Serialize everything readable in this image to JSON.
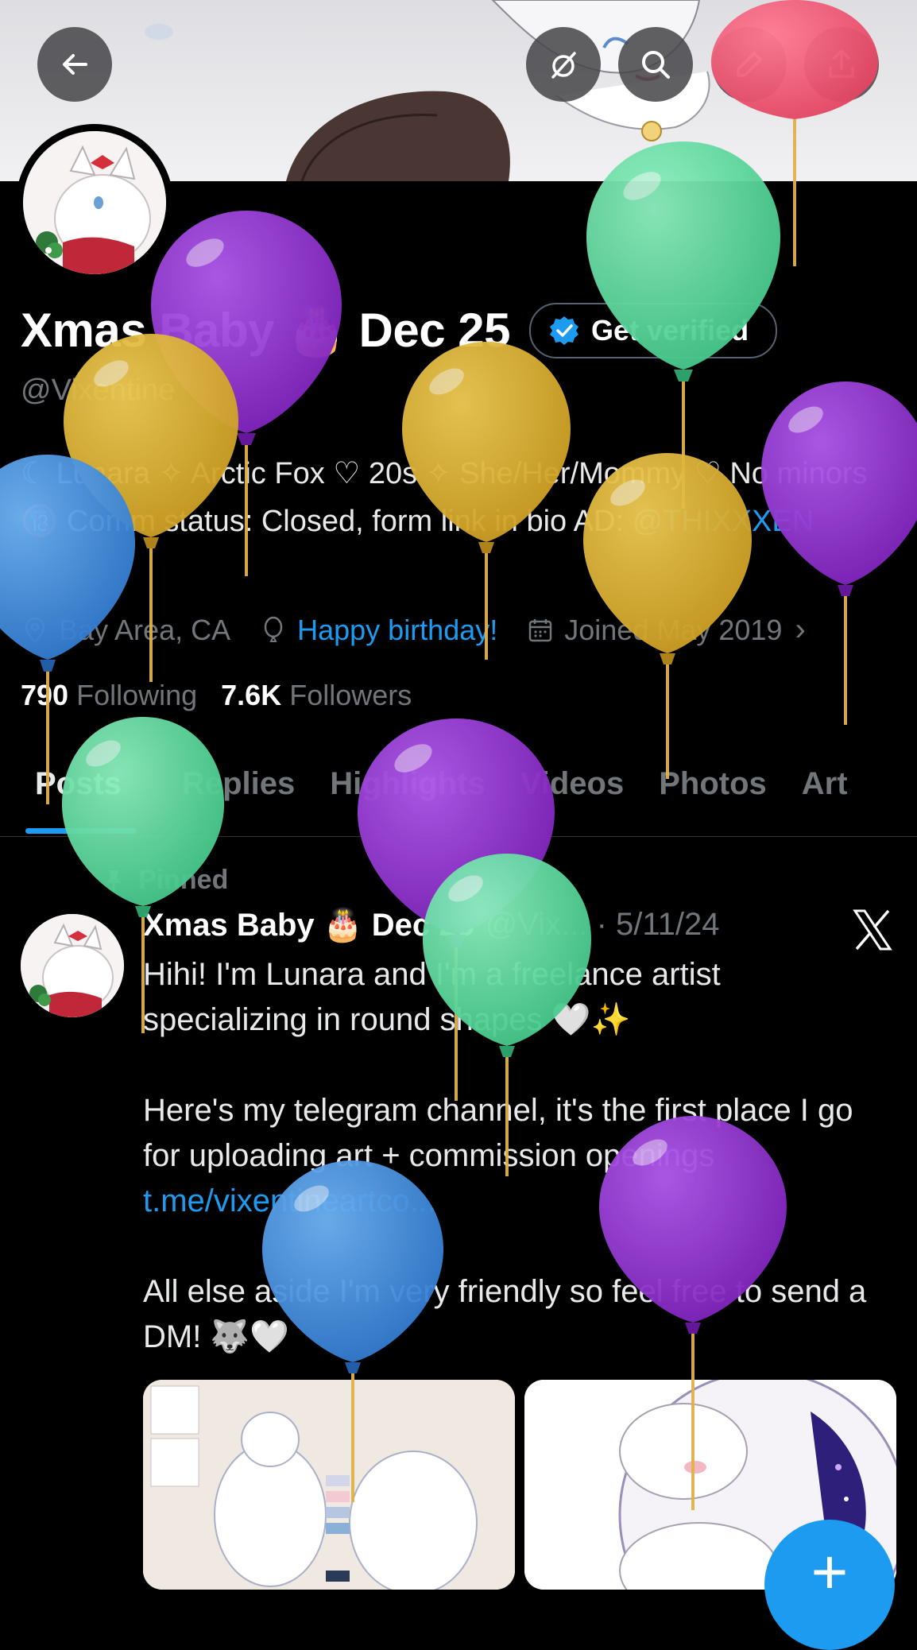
{
  "header": {
    "back_icon": "arrow-left-icon",
    "right_icons": [
      "no-signal-icon",
      "search-icon",
      "edit-icon",
      "share-icon"
    ]
  },
  "profile": {
    "display_name": "Xmas Baby 🎂 Dec 25",
    "verify_label": "Get verified",
    "handle": "@Vixentine",
    "bio_text": "☾ Lunara ✧ Arctic Fox ♡ 20s ✧ She/Her/Mommy ♡ No minors 🔞 Comm status: Closed, form link in bio AD:",
    "bio_link": "@THIXXXEN",
    "location": "Bay Area, CA",
    "birthday": "Happy birthday!",
    "joined": "Joined May 2019",
    "following_count": "790",
    "following_label": "Following",
    "followers_count": "7.6K",
    "followers_label": "Followers"
  },
  "tabs": [
    "Posts",
    "Replies",
    "Highlights",
    "Videos",
    "Photos",
    "Art"
  ],
  "post": {
    "pinned_label": "Pinned",
    "author": "Xmas Baby 🎂 Dec 25",
    "handle_date": "@Vix... · 5/11/24",
    "para1": "Hihi! I'm Lunara and I'm a freelance artist specializing in round shapes 🤍✨",
    "para2": "Here's my telegram channel, it's the first place I go for uploading art + commission openings",
    "link": "t.me/vixentineartco...",
    "para3": "All else aside I'm very friendly so feel free to send a DM! 🐺🤍"
  },
  "colors": {
    "accent": "#1d9bf0",
    "balloon_purple": "#8a2fc7",
    "balloon_yellow": "#e3b83a",
    "balloon_green": "#5cd99c",
    "balloon_blue": "#3d8ee0",
    "balloon_red": "#f0506e"
  },
  "fab_icon": "plus-icon"
}
